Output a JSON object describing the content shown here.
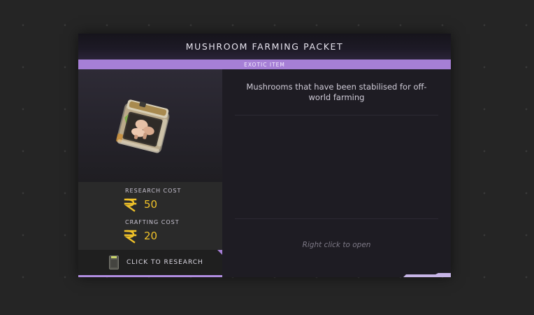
{
  "item": {
    "title": "MUSHROOM FARMING PACKET",
    "rarity": "EXOTIC ITEM",
    "icon": "mushroom-packet-icon",
    "description": "Mushrooms that have been stabilised for off-world farming",
    "hint": "Right click to open"
  },
  "costs": {
    "research_label": "RESEARCH COST",
    "research_value": "50",
    "crafting_label": "CRAFTING COST",
    "crafting_value": "20",
    "currency_icon": "rupee-currency-icon"
  },
  "actions": {
    "research_label": "CLICK TO RESEARCH",
    "research_icon": "research-card-icon"
  },
  "colors": {
    "rarity": "#a67fd6",
    "currency": "#f0c229",
    "background": "#252525",
    "panel": "#1e1c23"
  }
}
